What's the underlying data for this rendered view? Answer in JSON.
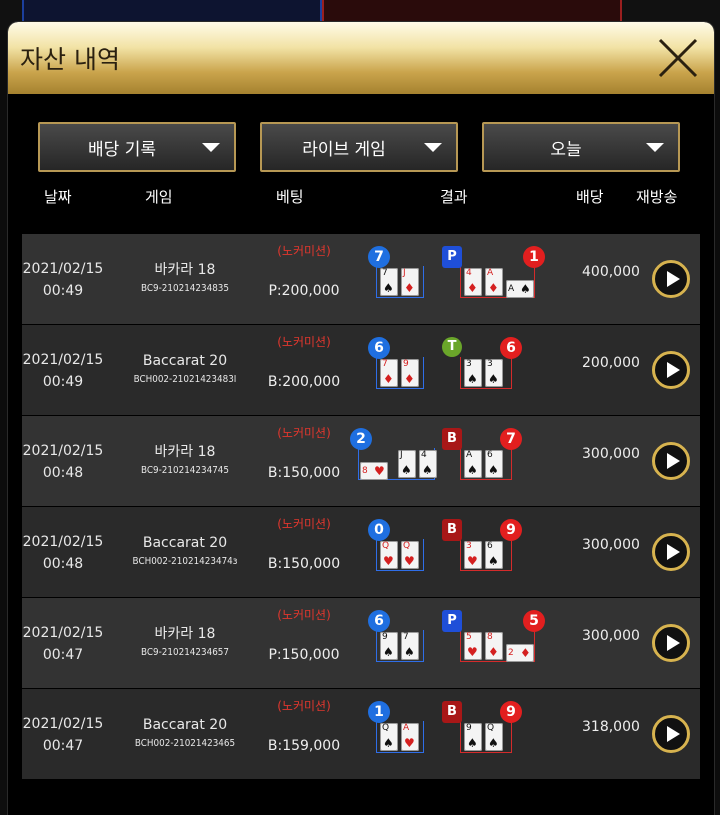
{
  "modal": {
    "title": "자산 내역"
  },
  "filters": [
    {
      "label": "배당 기록"
    },
    {
      "label": "라이브 게임"
    },
    {
      "label": "오늘"
    }
  ],
  "columns": [
    "날짜",
    "게임",
    "베팅",
    "결과",
    "배당",
    "재방송"
  ],
  "rows": [
    {
      "date": "2021/02/15",
      "time": "00:49",
      "game": "바카라 18",
      "game_id": "BC9-210214234835",
      "bet_note": "(노커미션)",
      "bet": "P:200,000",
      "payout": "400,000",
      "player_score": "7",
      "banker_score": "1",
      "winner": "P",
      "player_cards": [
        [
          "7",
          "♠",
          "k"
        ],
        [
          "J",
          "♦",
          "r"
        ]
      ],
      "banker_cards": [
        [
          "4",
          "♦",
          "r"
        ],
        [
          "A",
          "♦",
          "r"
        ],
        [
          "A",
          "♠",
          "k"
        ]
      ]
    },
    {
      "date": "2021/02/15",
      "time": "00:49",
      "game": "Baccarat 20",
      "game_id": "BCH002-21021423483I",
      "bet_note": "(노커미션)",
      "bet": "B:200,000",
      "payout": "200,000",
      "player_score": "6",
      "banker_score": "6",
      "winner": "T",
      "player_cards": [
        [
          "7",
          "♦",
          "r"
        ],
        [
          "9",
          "♦",
          "r"
        ]
      ],
      "banker_cards": [
        [
          "3",
          "♠",
          "k"
        ],
        [
          "3",
          "♠",
          "k"
        ]
      ]
    },
    {
      "date": "2021/02/15",
      "time": "00:48",
      "game": "바카라 18",
      "game_id": "BC9-210214234745",
      "bet_note": "(노커미션)",
      "bet": "B:150,000",
      "payout": "300,000",
      "player_score": "2",
      "banker_score": "7",
      "winner": "B",
      "player_cards": [
        [
          "8",
          "♥",
          "r"
        ],
        [
          "J",
          "♠",
          "k"
        ],
        [
          "4",
          "♠",
          "k"
        ]
      ],
      "banker_cards": [
        [
          "A",
          "♠",
          "k"
        ],
        [
          "6",
          "♠",
          "k"
        ]
      ]
    },
    {
      "date": "2021/02/15",
      "time": "00:48",
      "game": "Baccarat 20",
      "game_id": "BCH002-21021423474з",
      "bet_note": "(노커미션)",
      "bet": "B:150,000",
      "payout": "300,000",
      "player_score": "0",
      "banker_score": "9",
      "winner": "B",
      "player_cards": [
        [
          "Q",
          "♥",
          "r"
        ],
        [
          "Q",
          "♥",
          "r"
        ]
      ],
      "banker_cards": [
        [
          "3",
          "♥",
          "r"
        ],
        [
          "6",
          "♠",
          "k"
        ]
      ]
    },
    {
      "date": "2021/02/15",
      "time": "00:47",
      "game": "바카라 18",
      "game_id": "BC9-210214234657",
      "bet_note": "(노커미션)",
      "bet": "P:150,000",
      "payout": "300,000",
      "player_score": "6",
      "banker_score": "5",
      "winner": "P",
      "player_cards": [
        [
          "9",
          "♠",
          "k"
        ],
        [
          "7",
          "♠",
          "k"
        ]
      ],
      "banker_cards": [
        [
          "5",
          "♥",
          "r"
        ],
        [
          "8",
          "♦",
          "r"
        ],
        [
          "2",
          "♦",
          "r"
        ]
      ]
    },
    {
      "date": "2021/02/15",
      "time": "00:47",
      "game": "Baccarat 20",
      "game_id": "BCH002-21021423465",
      "bet_note": "(노커미션)",
      "bet": "B:159,000",
      "payout": "318,000",
      "player_score": "1",
      "banker_score": "9",
      "winner": "B",
      "player_cards": [
        [
          "Q",
          "♠",
          "k"
        ],
        [
          "A",
          "♥",
          "r"
        ]
      ],
      "banker_cards": [
        [
          "9",
          "♠",
          "k"
        ],
        [
          "Q",
          "♠",
          "k"
        ]
      ]
    }
  ]
}
